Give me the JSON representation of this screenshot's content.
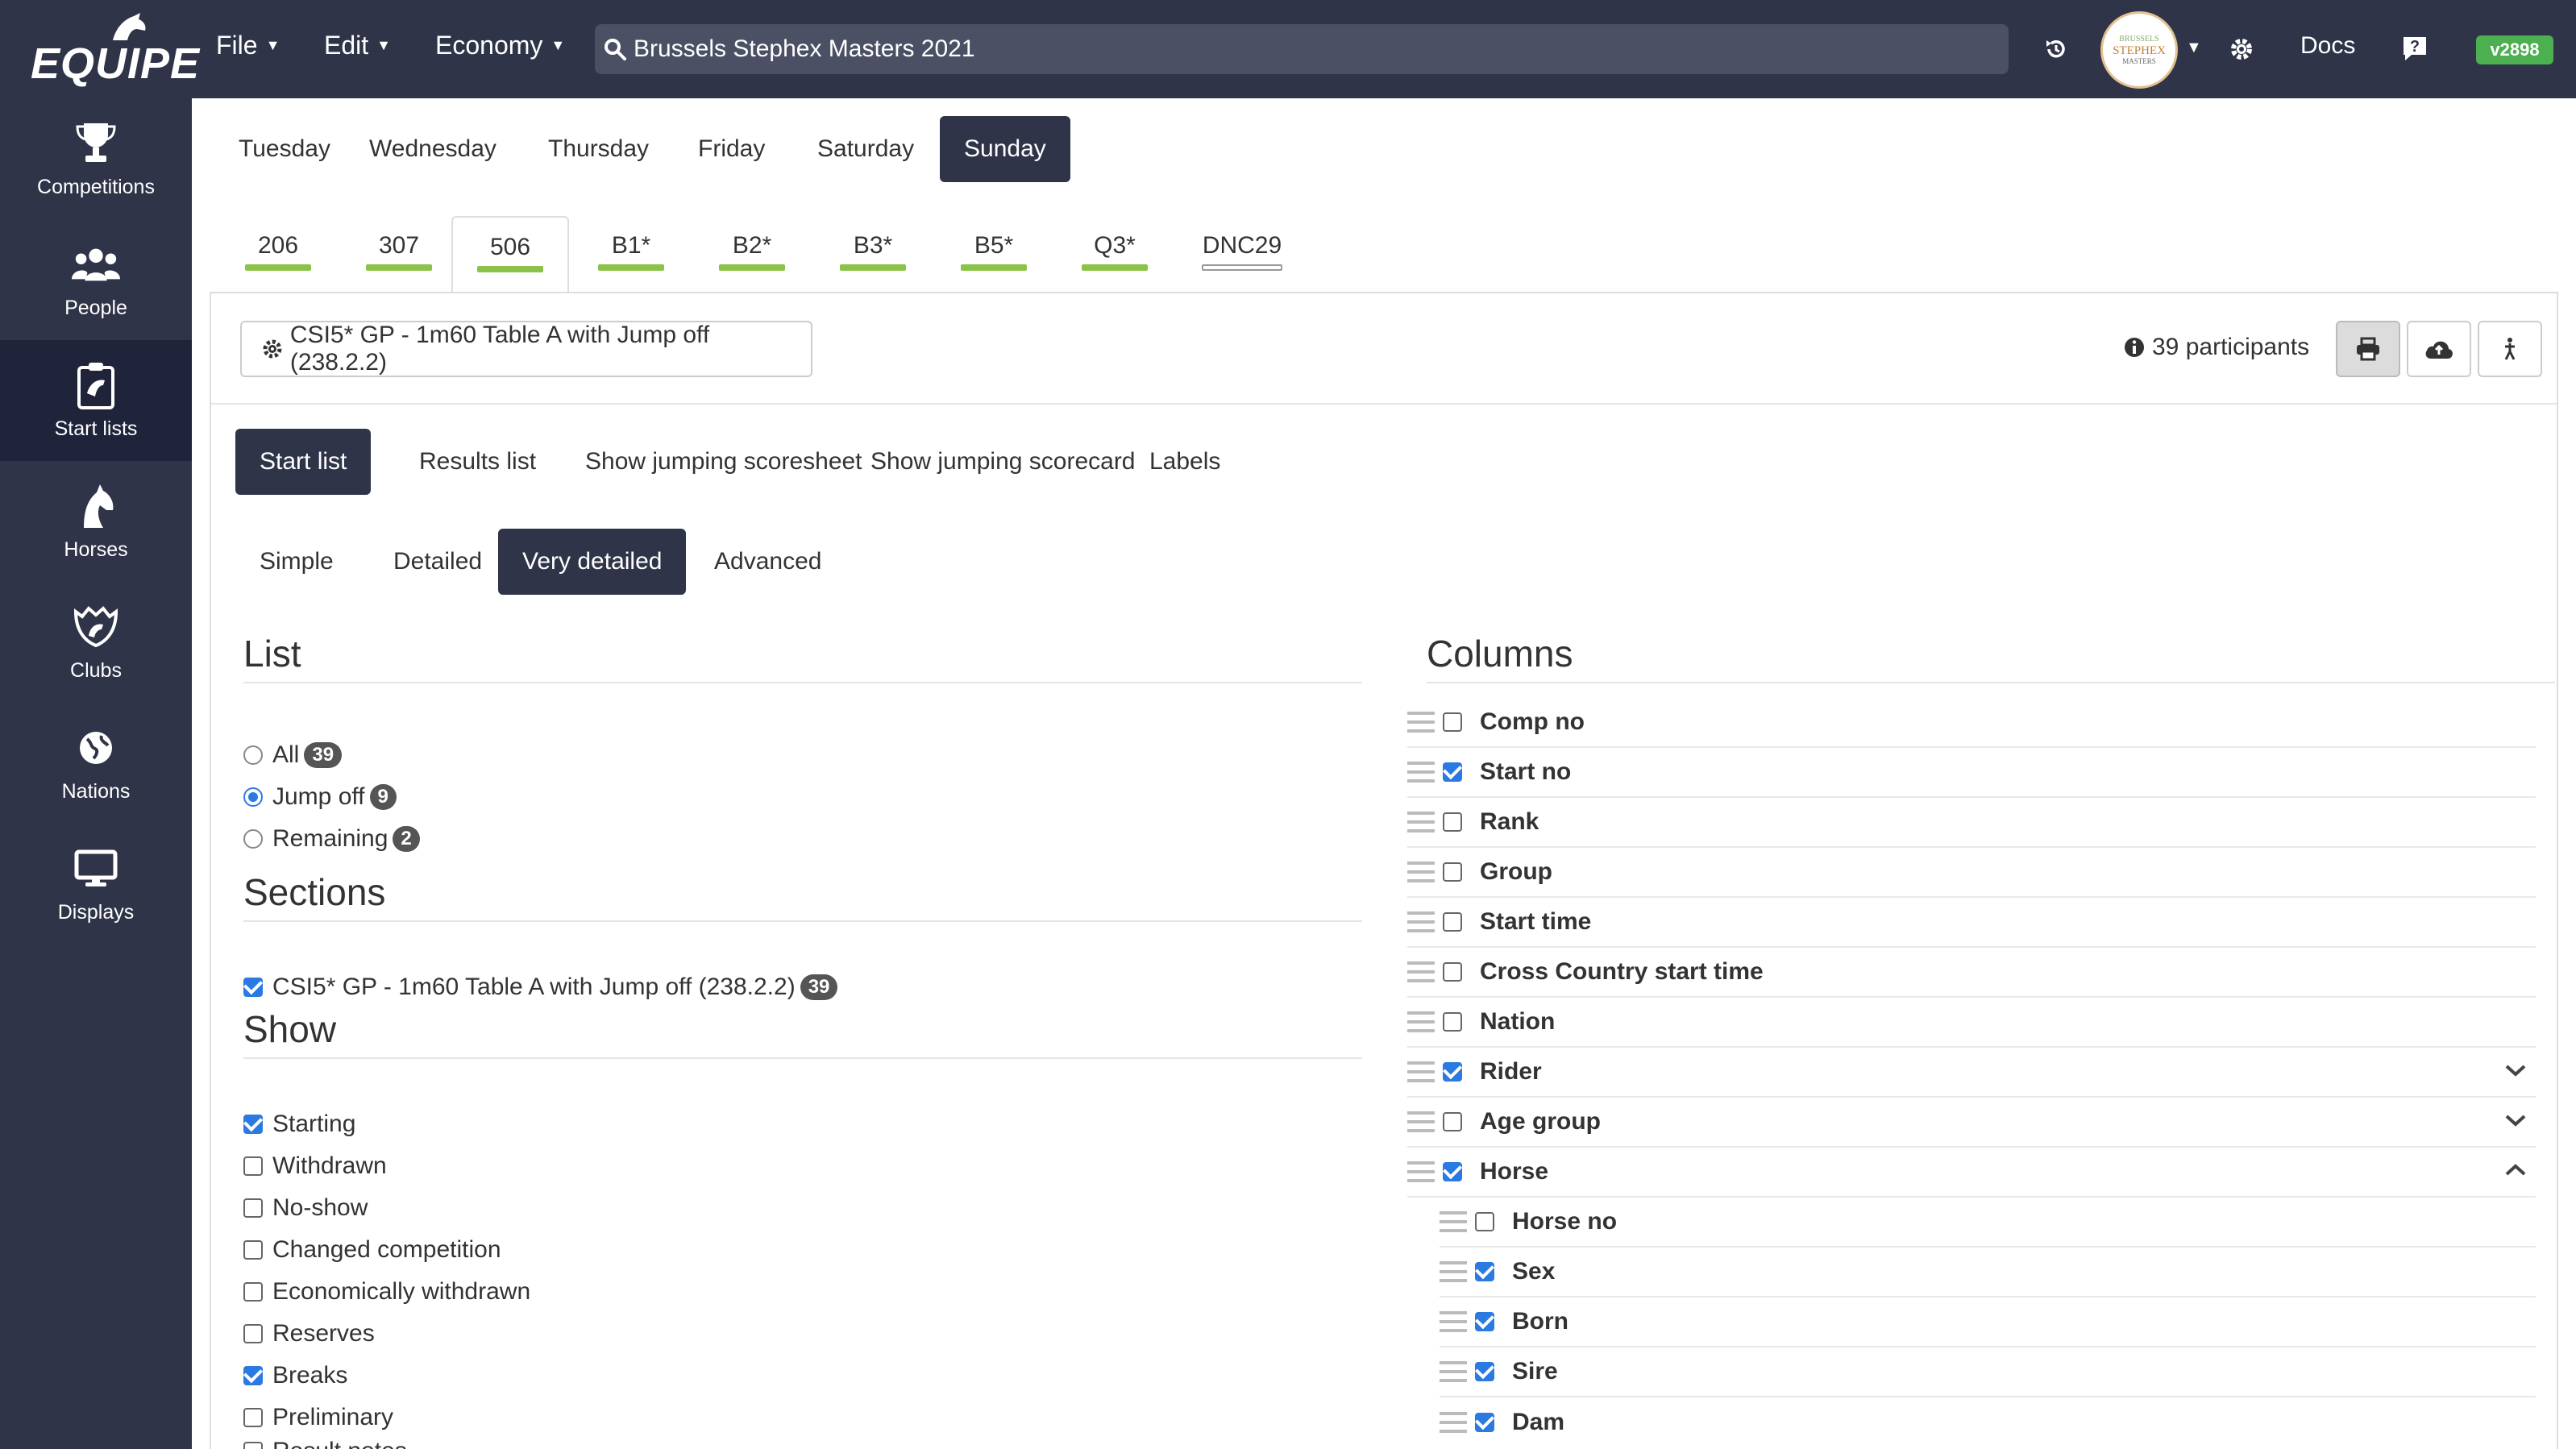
{
  "app": {
    "logo": "EQUIPE",
    "version": "v2898"
  },
  "menus": [
    {
      "label": "File"
    },
    {
      "label": "Edit"
    },
    {
      "label": "Economy"
    }
  ],
  "search": {
    "value": "Brussels Stephex Masters 2021"
  },
  "avatar": {
    "line1": "BRUSSELS",
    "line2": "STEPHEX",
    "line3": "MASTERS"
  },
  "header": {
    "docs": "Docs"
  },
  "sidebar": {
    "items": [
      {
        "label": "Competitions",
        "icon": "trophy-icon"
      },
      {
        "label": "People",
        "icon": "people-icon"
      },
      {
        "label": "Start lists",
        "icon": "start-lists-icon",
        "active": true
      },
      {
        "label": "Horses",
        "icon": "horse-icon"
      },
      {
        "label": "Clubs",
        "icon": "clubs-icon"
      },
      {
        "label": "Nations",
        "icon": "globe-icon"
      },
      {
        "label": "Displays",
        "icon": "monitor-icon"
      }
    ]
  },
  "days": [
    "Tuesday",
    "Wednesday",
    "Thursday",
    "Friday",
    "Saturday",
    "Sunday"
  ],
  "active_day": "Sunday",
  "competitions": [
    {
      "label": "206",
      "complete": true
    },
    {
      "label": "307",
      "complete": true
    },
    {
      "label": "506",
      "complete": true,
      "active": true
    },
    {
      "label": "B1*",
      "complete": true
    },
    {
      "label": "B2*",
      "complete": true
    },
    {
      "label": "B3*",
      "complete": true
    },
    {
      "label": "B5*",
      "complete": true
    },
    {
      "label": "Q3*",
      "complete": true
    },
    {
      "label": "DNC29",
      "complete": false
    }
  ],
  "competition_select": {
    "label": "CSI5* GP - 1m60 Table A with Jump off (238.2.2)"
  },
  "participants": {
    "text": "39 participants"
  },
  "list_types": [
    "Start list",
    "Results list",
    "Show jumping scoresheet",
    "Show jumping scorecard",
    "Labels"
  ],
  "active_list_type": "Start list",
  "detail_levels": [
    "Simple",
    "Detailed",
    "Very detailed",
    "Advanced"
  ],
  "active_detail_level": "Very detailed",
  "list_section": {
    "title": "List",
    "options": [
      {
        "label": "All",
        "count": "39",
        "selected": false
      },
      {
        "label": "Jump off",
        "count": "9",
        "selected": true
      },
      {
        "label": "Remaining",
        "count": "2",
        "selected": false
      }
    ]
  },
  "sections_section": {
    "title": "Sections",
    "items": [
      {
        "label": "CSI5* GP - 1m60 Table A with Jump off (238.2.2)",
        "count": "39",
        "checked": true
      }
    ]
  },
  "show_section": {
    "title": "Show",
    "items": [
      {
        "label": "Starting",
        "checked": true
      },
      {
        "label": "Withdrawn",
        "checked": false
      },
      {
        "label": "No-show",
        "checked": false
      },
      {
        "label": "Changed competition",
        "checked": false
      },
      {
        "label": "Economically withdrawn",
        "checked": false
      },
      {
        "label": "Reserves",
        "checked": false
      },
      {
        "label": "Breaks",
        "checked": true
      },
      {
        "label": "Preliminary",
        "checked": false
      },
      {
        "label": "Result notes",
        "checked": false
      }
    ]
  },
  "columns_section": {
    "title": "Columns",
    "items": [
      {
        "label": "Comp no",
        "checked": false
      },
      {
        "label": "Start no",
        "checked": true
      },
      {
        "label": "Rank",
        "checked": false
      },
      {
        "label": "Group",
        "checked": false
      },
      {
        "label": "Start time",
        "checked": false
      },
      {
        "label": "Cross Country start time",
        "checked": false
      },
      {
        "label": "Nation",
        "checked": false
      },
      {
        "label": "Rider",
        "checked": true,
        "expander": "down"
      },
      {
        "label": "Age group",
        "checked": false,
        "expander": "down"
      },
      {
        "label": "Horse",
        "checked": true,
        "expander": "up"
      },
      {
        "label": "Horse no",
        "checked": false,
        "sub": true
      },
      {
        "label": "Sex",
        "checked": true,
        "sub": true
      },
      {
        "label": "Born",
        "checked": true,
        "sub": true
      },
      {
        "label": "Sire",
        "checked": true,
        "sub": true
      },
      {
        "label": "Dam",
        "checked": true,
        "sub": true
      }
    ]
  }
}
